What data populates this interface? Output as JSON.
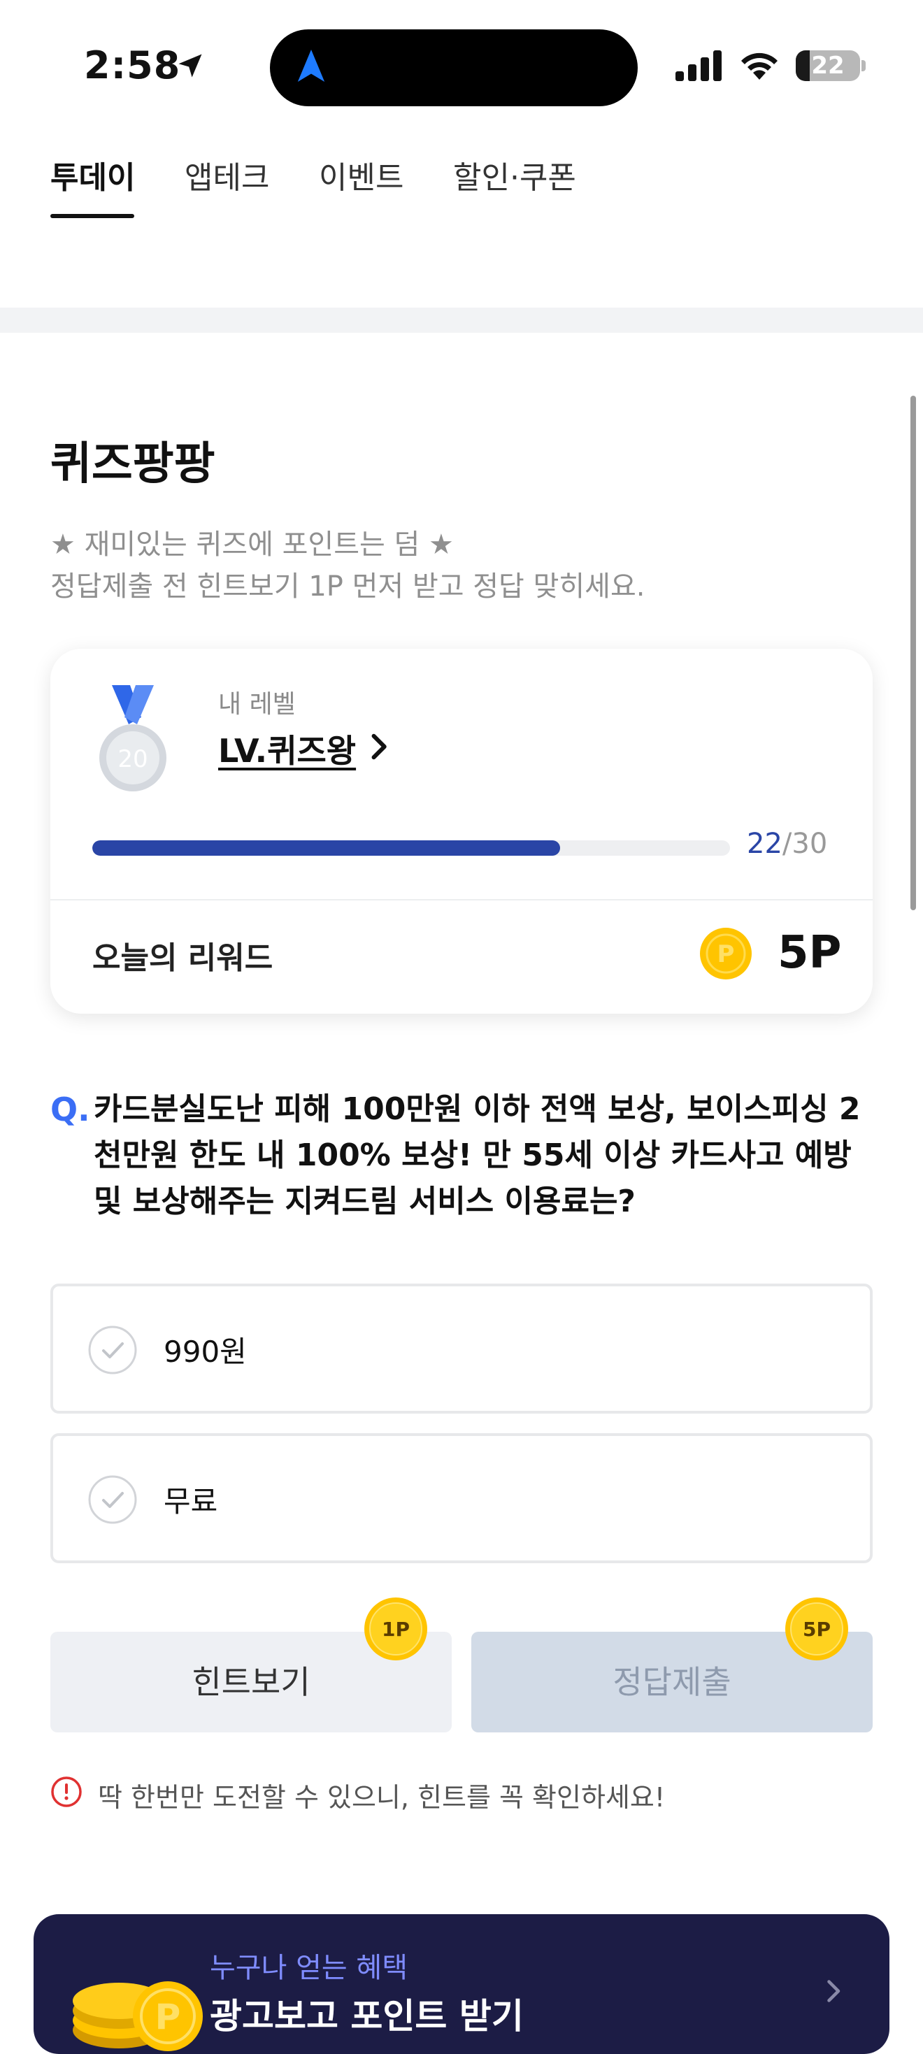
{
  "status_bar": {
    "time": "2:58",
    "battery": "22",
    "battery_level": 0.22
  },
  "tabs": [
    {
      "label": "투데이",
      "active": true
    },
    {
      "label": "앱테크",
      "active": false
    },
    {
      "label": "이벤트",
      "active": false
    },
    {
      "label": "할인·쿠폰",
      "active": false
    }
  ],
  "quiz": {
    "title": "퀴즈팡팡",
    "subtitle_1": "★ 재미있는 퀴즈에 포인트는 덤 ★",
    "subtitle_2": "정답제출 전 힌트보기 1P 먼저 받고 정답 맞히세요."
  },
  "level_card": {
    "medal_number": "20",
    "label": "내 레벨",
    "level_name": "LV.퀴즈왕",
    "progress_current": "22",
    "progress_sep": "/",
    "progress_total": "30",
    "progress_fraction": 0.7333,
    "reward_label": "오늘의 리워드",
    "coin_letter": "P",
    "reward_value": "5P"
  },
  "question": {
    "prefix": "Q.",
    "text": "카드분실도난 피해 100만원 이하 전액 보상, 보이스피싱 2천만원 한도 내 100% 보상! 만 55세 이상 카드사고 예방 및 보상해주는 지켜드림 서비스 이용료는?",
    "options": [
      "990원",
      "무료"
    ]
  },
  "buttons": {
    "hint_label": "힌트보기",
    "hint_points": "1P",
    "submit_label": "정답제출",
    "submit_points": "5P"
  },
  "notice": "딱 한번만 도전할 수 있으니, 힌트를 꼭 확인하세요!",
  "banner": {
    "subtitle": "누구나 얻는 혜택",
    "title": "광고보고 포인트 받기"
  },
  "colors": {
    "accent_blue": "#2a45a6",
    "question_blue": "#3b6ef5",
    "coin_gold": "#ffc400",
    "notice_red": "#e03131",
    "banner_bg": "#1c1c45"
  }
}
